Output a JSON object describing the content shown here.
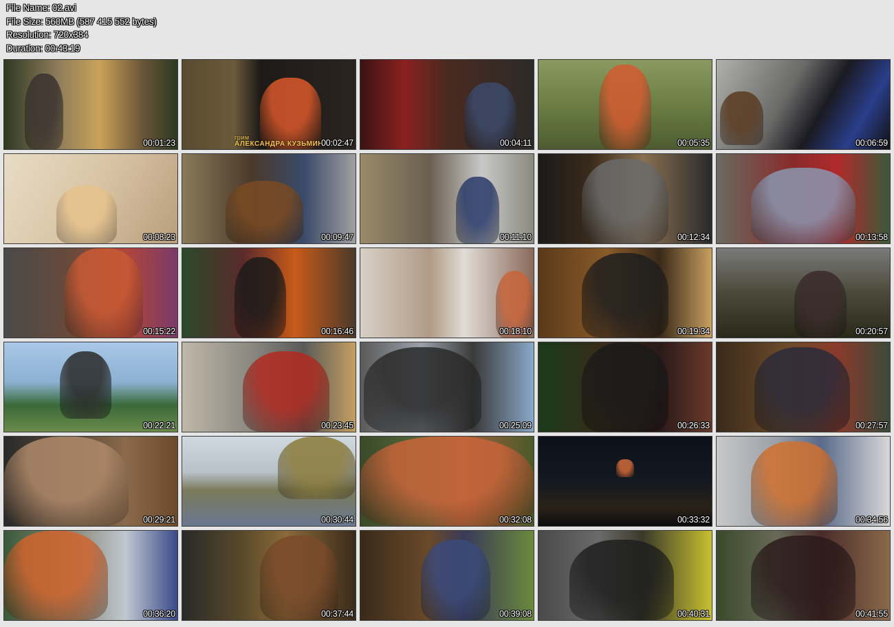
{
  "info": {
    "file_name": "File Name: 02.avi",
    "file_size": "File Size: 560MB (587 415 552 bytes)",
    "resolution": "Resolution: 720x384",
    "duration": "Duration: 00:43:19"
  },
  "thumbs": [
    {
      "time": "00:01:23",
      "bg": "linear-gradient(90deg,#2f3a22 0%,#8b7a5a 30%,#c9a35a 55%,#6a5438 80%,#2b3a20 100%)",
      "fig": "#3a3230"
    },
    {
      "time": "00:02:47",
      "bg": "linear-gradient(90deg,#5a4a2e 0%,#6b5a3a 30%,#1e1a18 45%,#2a2420 100%)",
      "fig": "#d9582a",
      "caption_small": "грим",
      "caption_big": "АЛЕКСАНДРА КУЗЬМИНА"
    },
    {
      "time": "00:04:11",
      "bg": "linear-gradient(90deg,#3a1414 0%,#8a2020 25%,#4a2a20 50%,#2c2a28 100%)",
      "fig": "#3b4a6a"
    },
    {
      "time": "00:05:35",
      "bg": "linear-gradient(180deg,#8a9a60 0%,#6c7e44 50%,#4d5c30 100%)",
      "fig": "#d35a30"
    },
    {
      "time": "00:06:59",
      "bg": "linear-gradient(120deg,#b0b0ae 0%,#6a6a68 40%,#1a1a22 60%,#2a3e8a 80%,#111 100%)",
      "fig": "#5a3a20"
    },
    {
      "time": "00:08:23",
      "bg": "linear-gradient(120deg,#e8dcc6 0%,#d8c4a4 50%,#b89e7c 100%)",
      "fig": "#e6c28c"
    },
    {
      "time": "00:09:47",
      "bg": "linear-gradient(90deg,#8a7a5a 0%,#4a3a2a 40%,#3a4a6a 70%,#a0a0a0 100%)",
      "fig": "#7a4a22"
    },
    {
      "time": "00:11:10",
      "bg": "linear-gradient(90deg,#9a8a6a 0%,#6a6050 40%,#c8c8c8 70%,#8a8a80 100%)",
      "fig": "#2a3a6a"
    },
    {
      "time": "00:12:34",
      "bg": "linear-gradient(90deg,#1a1a1a 0%,#3a2a1a 30%,#8a7050 60%,#2a2a2a 100%)",
      "fig": "#6a6a6a"
    },
    {
      "time": "00:13:58",
      "bg": "linear-gradient(90deg,#6a6a60 0%,#8a2a2a 45%,#b02a2a 70%,#3a5a3a 100%)",
      "fig": "#8a96b0"
    },
    {
      "time": "00:15:22",
      "bg": "linear-gradient(90deg,#4a4a4a 0%,#6a4a3a 40%,#b0463a 70%,#7a3a6a 100%)",
      "fig": "#c85a34"
    },
    {
      "time": "00:16:46",
      "bg": "linear-gradient(90deg,#2a4a2a 0%,#5a2a2a 35%,#c85a1a 65%,#4a3a2a 100%)",
      "fig": "#1a1a1a"
    },
    {
      "time": "00:18:10",
      "bg": "linear-gradient(90deg,#d8d0c6 0%,#b09a86 40%,#e0dcd6 60%,#8a6a5a 100%)",
      "fig": "#c8643a"
    },
    {
      "time": "00:19:34",
      "bg": "linear-gradient(90deg,#5a3a1a 0%,#8a5a2a 40%,#3a2a1a 70%,#c8a060 100%)",
      "fig": "#1e1e1e"
    },
    {
      "time": "00:20:57",
      "bg": "linear-gradient(180deg,#7a7a7a 0%,#4a4a3a 50%,#2a2a1a 100%)",
      "fig": "#3a2a2a"
    },
    {
      "time": "00:22:21",
      "bg": "linear-gradient(180deg,#aac8e8 0%,#8ab0d0 45%,#3a6a3a 70%,#6a8a4a 100%)",
      "fig": "#2a2a2a"
    },
    {
      "time": "00:23:45",
      "bg": "linear-gradient(90deg,#c0b8a8 0%,#8a8880 40%,#5a5a5a 70%,#c4a060 100%)",
      "fig": "#b02a20"
    },
    {
      "time": "00:25:09",
      "bg": "linear-gradient(90deg,#5a5a5a 0%,#9aa0a8 35%,#3a3a3a 65%,#8aa8c8 100%)",
      "fig": "#2a2a2a"
    },
    {
      "time": "00:26:33",
      "bg": "linear-gradient(90deg,#1a3a1a 0%,#3a2a1a 40%,#2a1a1a 70%,#6a3a2a 100%)",
      "fig": "#1a1a1a"
    },
    {
      "time": "00:27:57",
      "bg": "linear-gradient(90deg,#3a2a1a 0%,#6a4a2a 40%,#8a3a2a 70%,#3a4a3a 100%)",
      "fig": "#2a2a3a"
    },
    {
      "time": "00:29:21",
      "bg": "linear-gradient(90deg,#2a2a2a 0%,#5a4a3a 40%,#8a6a4a 70%,#6a4a2a 100%)",
      "fig": "#b08a6a"
    },
    {
      "time": "00:30:44",
      "bg": "linear-gradient(180deg,#d0d8e0 0%,#b8c0c8 40%,#7a7a5a 60%,#6a7890 100%)",
      "fig": "#8a7a3a"
    },
    {
      "time": "00:32:08",
      "bg": "linear-gradient(90deg,#3a4a2a 0%,#5a6a3a 40%,#a0603a 60%,#4a5a2a 100%)",
      "fig": "#c8643a"
    },
    {
      "time": "00:33:32",
      "bg": "linear-gradient(180deg,#0c1018 0%,#141820 50%,#2a2218 80%,#0c0c10 100%)",
      "fig": "#d06a3a"
    },
    {
      "time": "00:34:56",
      "bg": "linear-gradient(90deg,#c8c8c8 0%,#9aa0a8 35%,#5a6a8a 60%,#d8d8d8 100%)",
      "fig": "#d0702e"
    },
    {
      "time": "00:36:20",
      "bg": "linear-gradient(90deg,#3a5a3a 0%,#8a8a7a 40%,#c0c8d0 70%,#3a4a8a 100%)",
      "fig": "#d0642e"
    },
    {
      "time": "00:37:44",
      "bg": "linear-gradient(90deg,#2a2a2a 0%,#5a4a2a 35%,#8a6a3a 60%,#3a2a1a 100%)",
      "fig": "#7a4a2a"
    },
    {
      "time": "00:39:08",
      "bg": "linear-gradient(90deg,#3a2a1a 0%,#6a4a2a 40%,#3a3a5a 60%,#6a8a3a 100%)",
      "fig": "#3a4a7a"
    },
    {
      "time": "00:40:31",
      "bg": "linear-gradient(90deg,#4a4a4a 0%,#6a6a6a 35%,#3a3a2a 60%,#c8c030 100%)",
      "fig": "#1e1e1e"
    },
    {
      "time": "00:41:55",
      "bg": "linear-gradient(90deg,#3a4a2a 0%,#6a6a5a 35%,#4a2a2a 60%,#8a6a4a 100%)",
      "fig": "#2a1a1a"
    }
  ]
}
